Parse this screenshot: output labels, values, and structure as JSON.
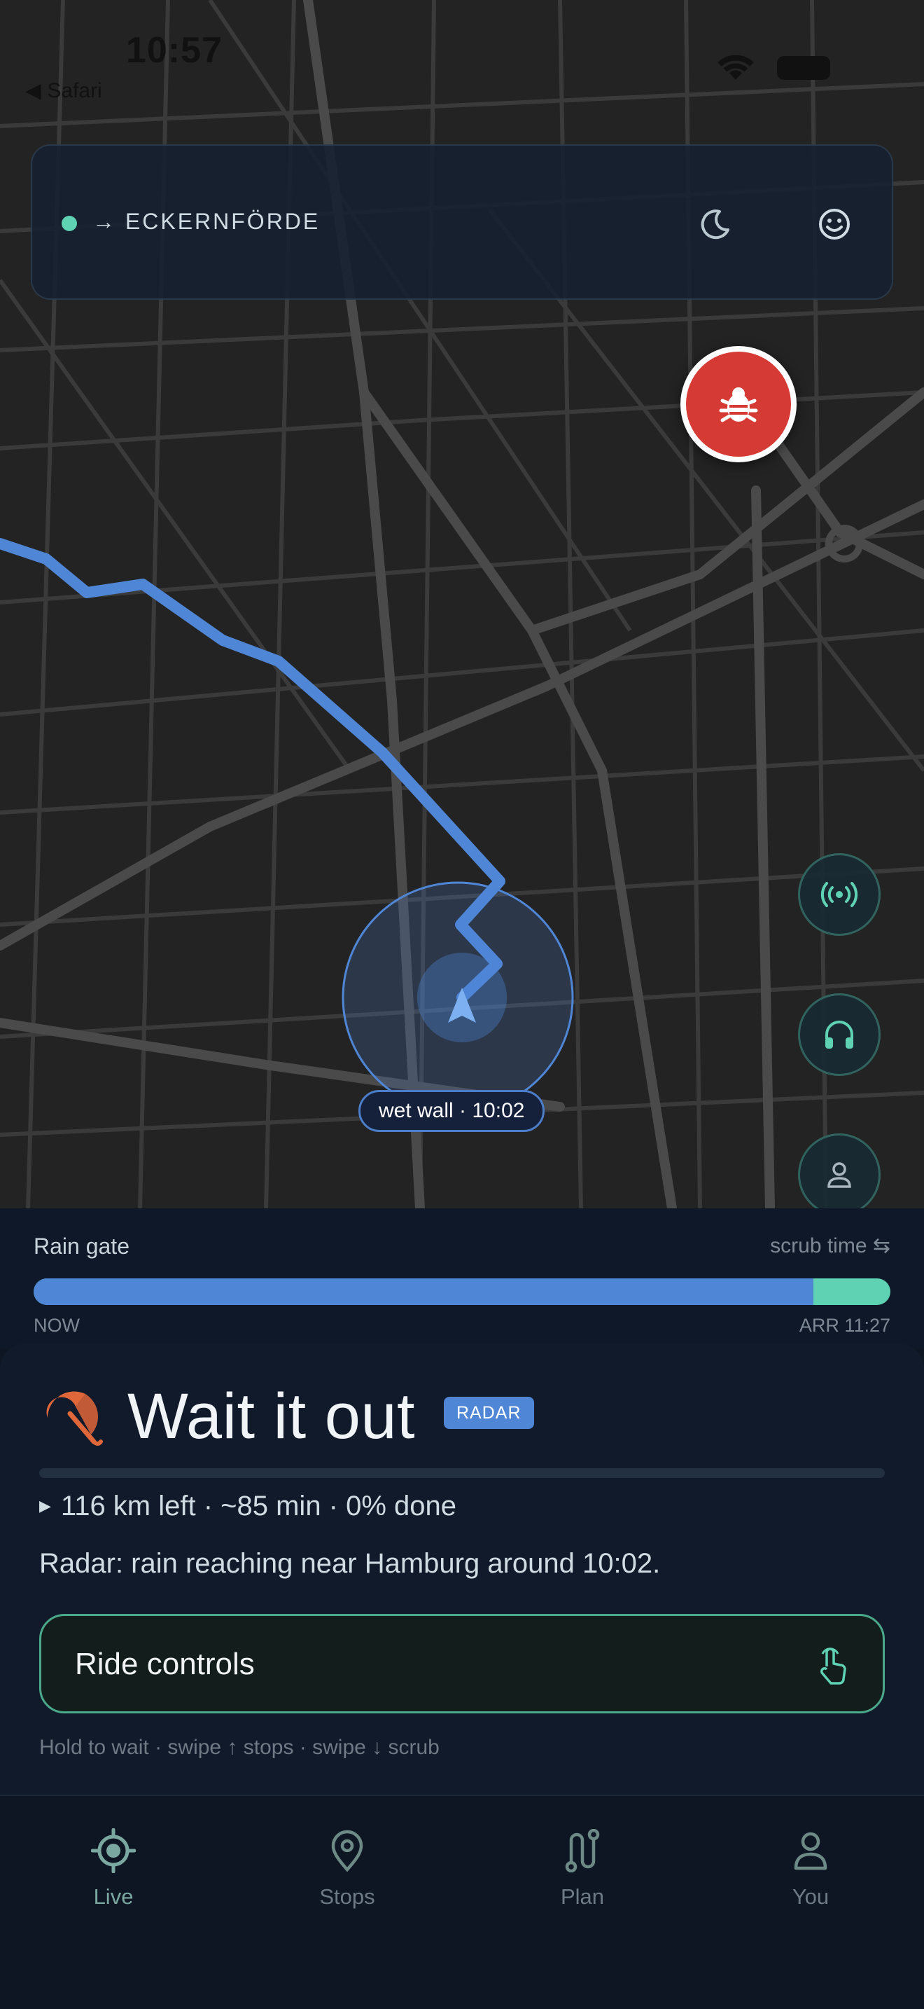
{
  "status": {
    "time": "10:57",
    "back_label": "◀ Safari"
  },
  "header": {
    "destination": "→ ECKERNFÖRDE",
    "moon_icon": "moon-icon",
    "face_icon": "smile-icon"
  },
  "map": {
    "wet_wall_label": "wet wall · 10:02"
  },
  "rain_gate": {
    "title": "Rain gate",
    "scrub_label": "scrub time ⇆",
    "start_label": "NOW",
    "end_label": "ARR 11:27",
    "wet_fraction": 0.91
  },
  "sheet": {
    "title": "Wait it out",
    "badge": "RADAR",
    "progress_fraction": 0.0,
    "stats": "116 km left · ~85 min · 0% done",
    "radar_note": "Radar: rain reaching near Hamburg around 10:02.",
    "ride_controls_label": "Ride controls",
    "hint": "Hold to wait · swipe ↑ stops · swipe ↓ scrub"
  },
  "tabs": [
    {
      "label": "Live",
      "icon": "crosshair-icon"
    },
    {
      "label": "Stops",
      "icon": "map-pin-icon"
    },
    {
      "label": "Plan",
      "icon": "route-icon"
    },
    {
      "label": "You",
      "icon": "user-icon"
    }
  ],
  "colors": {
    "accent": "#5fd2b3",
    "route": "#4f86d6",
    "alert": "#d63a34",
    "umbrella": "#e0673a"
  }
}
